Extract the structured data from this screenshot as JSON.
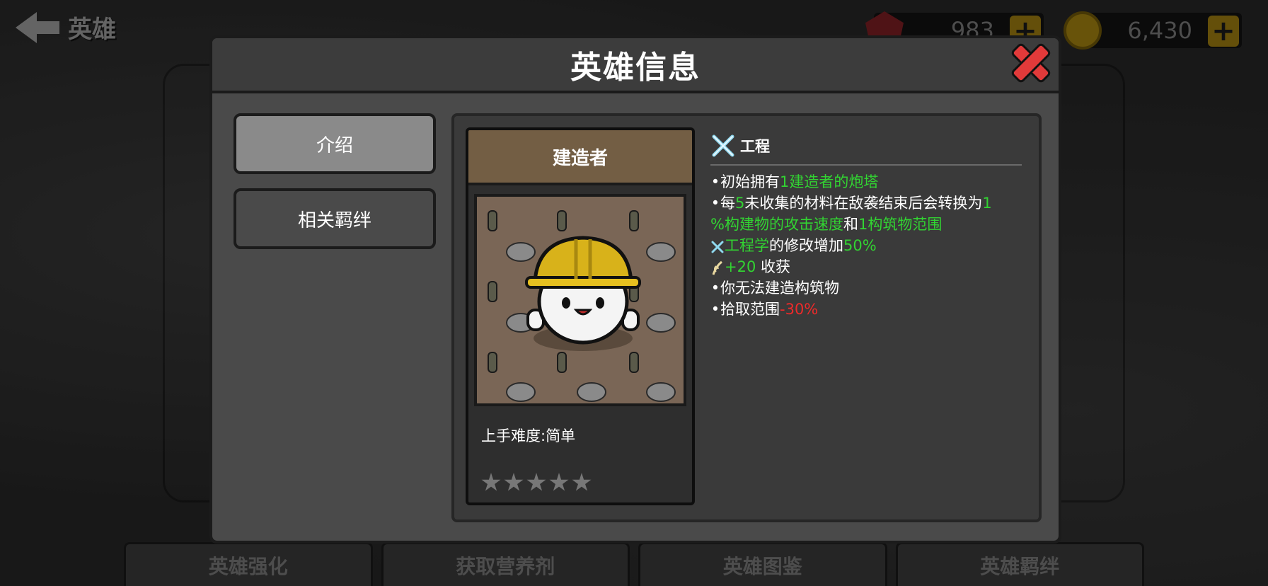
{
  "top": {
    "back_label": "英雄",
    "gems": "983",
    "coins": "6,430",
    "gem_icon": "red-gem-icon",
    "coin_icon": "gold-coin-icon"
  },
  "bottom_tabs": [
    "英雄强化",
    "获取营养剂",
    "英雄图鉴",
    "英雄羁绊"
  ],
  "modal": {
    "title": "英雄信息",
    "tabs": [
      "介绍",
      "相关羁绊"
    ],
    "active_tab": "介绍"
  },
  "hero": {
    "name": "建造者",
    "difficulty": "上手难度:简单",
    "stars_total": 5,
    "stars_filled": 0
  },
  "description": {
    "tag": "工程",
    "lines": {
      "l1a": "初始拥有",
      "l1b": "1建造者的炮塔",
      "l2a": "每",
      "l2b": "5",
      "l2c": "未收集的材料在敌袭结束后会转换为",
      "l2d": "1",
      "l3a": "%构建物的攻击速度",
      "l3b": "和",
      "l3c": "1构筑物范围",
      "l4a": "工程学",
      "l4b": "的修改增加",
      "l4c": "50%",
      "l5a": "+20",
      "l5b": " 收获",
      "l6": "你无法建造构筑物",
      "l7a": "拾取范围",
      "l7b": "-30%"
    }
  },
  "colors": {
    "positive": "#32d332",
    "negative": "#ee2a2a",
    "close": "#e23a3a",
    "hero_bar": "#735e44"
  }
}
